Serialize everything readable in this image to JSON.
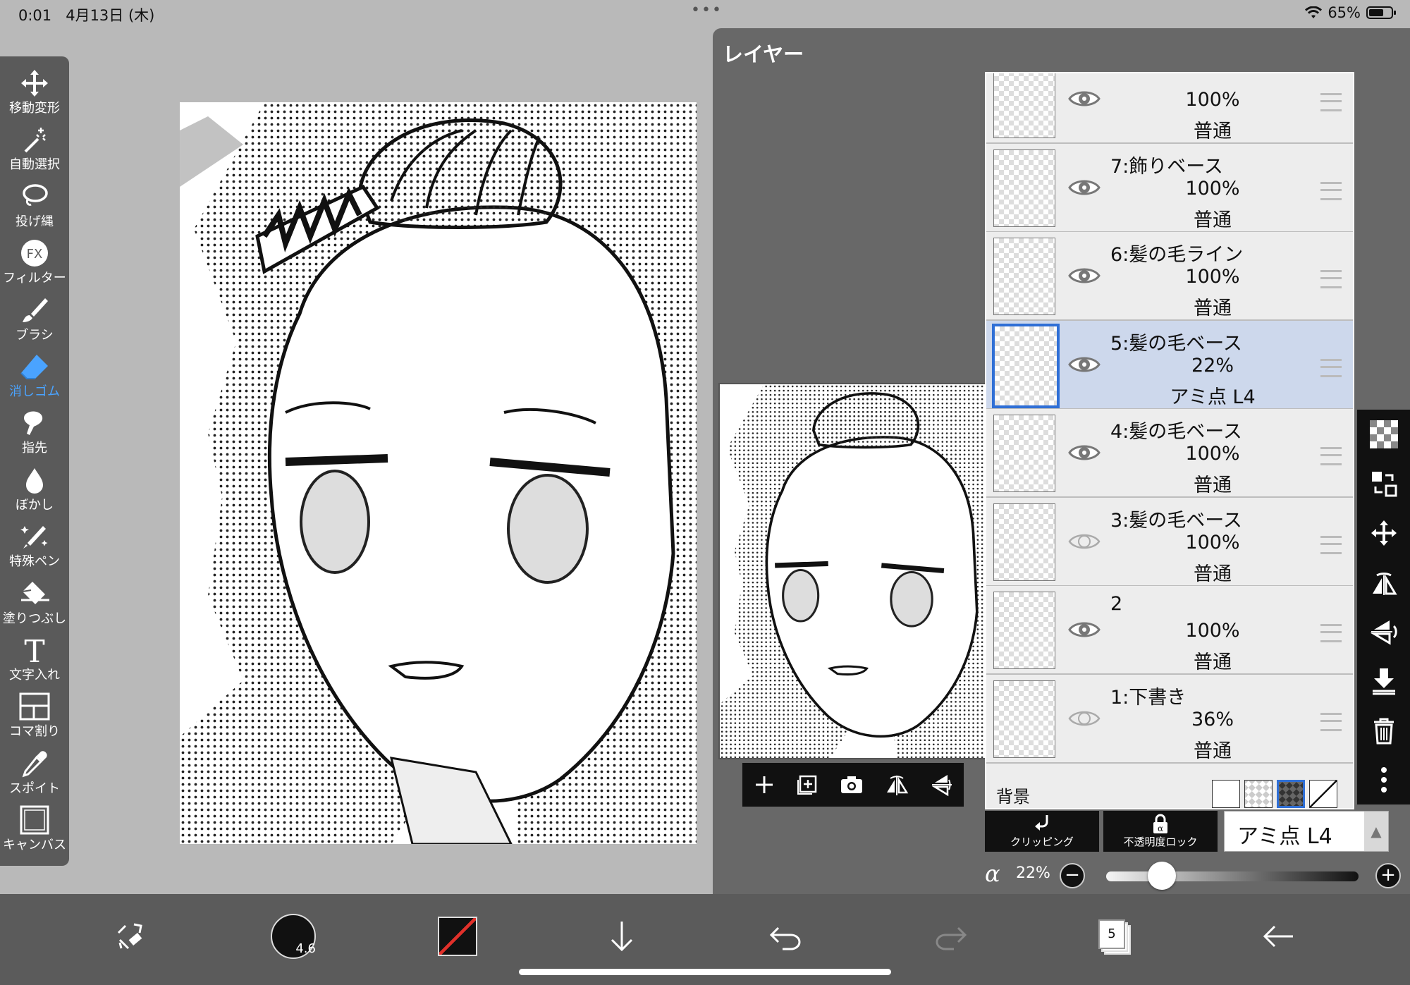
{
  "status": {
    "time": "0:01",
    "date": "4月13日 (木)",
    "dots": "•••",
    "battery": "65%",
    "battery_level": 0.65
  },
  "tools": [
    {
      "label": "移動変形",
      "icon": "move-icon"
    },
    {
      "label": "自動選択",
      "icon": "magic-wand-icon"
    },
    {
      "label": "投げ縄",
      "icon": "lasso-icon"
    },
    {
      "label": "フィルター",
      "icon": "fx-icon",
      "glyph": "FX"
    },
    {
      "label": "ブラシ",
      "icon": "brush-icon"
    },
    {
      "label": "消しゴム",
      "icon": "eraser-icon",
      "active": true
    },
    {
      "label": "指先",
      "icon": "finger-icon"
    },
    {
      "label": "ぼかし",
      "icon": "blur-drop-icon"
    },
    {
      "label": "特殊ペン",
      "icon": "special-pen-icon"
    },
    {
      "label": "塗りつぶし",
      "icon": "fill-bucket-icon"
    },
    {
      "label": "文字入れ",
      "icon": "text-icon",
      "glyph": "T"
    },
    {
      "label": "コマ割り",
      "icon": "frame-divider-icon"
    },
    {
      "label": "スポイト",
      "icon": "eyedropper-icon"
    },
    {
      "label": "キャンバス",
      "icon": "canvas-icon"
    }
  ],
  "panel": {
    "title": "レイヤー"
  },
  "layers": [
    {
      "name": "",
      "opacity": "100%",
      "blend": "普通",
      "visible": true,
      "selected": false
    },
    {
      "name": "7:飾りベース",
      "opacity": "100%",
      "blend": "普通",
      "visible": true,
      "selected": false
    },
    {
      "name": "6:髪の毛ライン",
      "opacity": "100%",
      "blend": "普通",
      "visible": true,
      "selected": false
    },
    {
      "name": "5:髪の毛ベース",
      "opacity": "22%",
      "blend": "アミ点 L4",
      "visible": true,
      "selected": true
    },
    {
      "name": "4:髪の毛ベース",
      "opacity": "100%",
      "blend": "普通",
      "visible": true,
      "selected": false
    },
    {
      "name": "3:髪の毛ベース",
      "opacity": "100%",
      "blend": "普通",
      "visible": false,
      "selected": false
    },
    {
      "name": "2",
      "opacity": "100%",
      "blend": "普通",
      "visible": true,
      "selected": false
    },
    {
      "name": "1:下書き",
      "opacity": "36%",
      "blend": "普通",
      "visible": false,
      "selected": false
    }
  ],
  "background": {
    "label": "背景"
  },
  "controls": {
    "clipping": "クリッピング",
    "opacity_lock": "不透明度ロック",
    "blend_mode": "アミ点 L4",
    "alpha_symbol": "α",
    "alpha_value": "22%",
    "alpha_fraction": 0.22,
    "minus": "−",
    "plus": "+"
  },
  "bottom": {
    "brush_size": "4.6",
    "layer_count": "5"
  },
  "colors": {
    "accent": "#2f6fd6",
    "panel": "#686868",
    "toolbar": "#5a5a5a"
  }
}
